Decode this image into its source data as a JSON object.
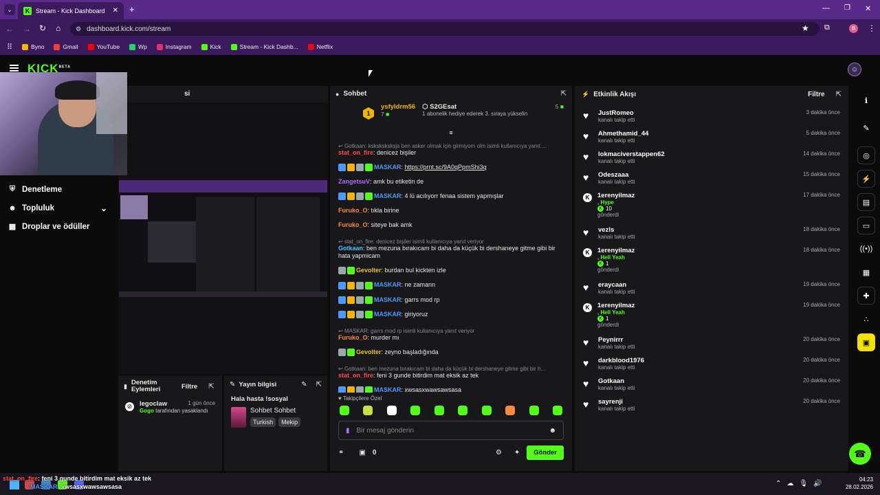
{
  "browser": {
    "tab_title": "Stream - Kick Dashboard",
    "url": "dashboard.kick.com/stream",
    "profile_initial": "B",
    "bookmarks": [
      {
        "label": "Byno",
        "color": "#f4b400"
      },
      {
        "label": "Gmail",
        "color": "#ea4335"
      },
      {
        "label": "YouTube",
        "color": "#ff0000"
      },
      {
        "label": "Wp",
        "color": "#25d366"
      },
      {
        "label": "Instagram",
        "color": "#e1306c"
      },
      {
        "label": "Kick",
        "color": "#53fc18"
      },
      {
        "label": "Stream - Kick Dashb...",
        "color": "#53fc18"
      },
      {
        "label": "Netflix",
        "color": "#e50914"
      }
    ]
  },
  "logo": {
    "text": "KICK",
    "beta": "BETA"
  },
  "sidebar": {
    "items": [
      {
        "label": "Denetleme",
        "icon": "shield-icon"
      },
      {
        "label": "Topluluk",
        "icon": "users-icon"
      },
      {
        "label": "Droplar ve ödüller",
        "icon": "gift-icon"
      }
    ]
  },
  "cam_partial_label": "si",
  "chat": {
    "title": "Sohbet",
    "top_user": "ysfyldrm56",
    "top_count": "7",
    "top_rank": "1",
    "second_user": "S2GEsat",
    "second_count": "5",
    "second_note": "1 abonelik hediye ederek 3. sıraya yükselin",
    "messages": [
      {
        "type": "reply",
        "text": "Gotkaan: ksksksksksjs ben asker olmak için girmiyom olm isimli kullanıcıya yanıt ..."
      },
      {
        "user": "stat_on_fire",
        "color": "#ff4b4b",
        "text": "denicez bişiler",
        "badges": []
      },
      {
        "user": "MASKAR",
        "color": "#4c9aff",
        "text": "https://prnt.sc/9A0qPpmShi3q",
        "link": true,
        "badges": [
          "#4c9aff",
          "#f4b400",
          "#9aa",
          "#53fc18"
        ]
      },
      {
        "user": "ZangetsuV",
        "color": "#b36bff",
        "text": "amk bu etiketin de",
        "badges": []
      },
      {
        "user": "MASKAR",
        "color": "#4c9aff",
        "text": "4 lü acılıyorr fenaa sistem yapmışlar",
        "badges": [
          "#4c9aff",
          "#f4b400",
          "#9aa",
          "#53fc18"
        ]
      },
      {
        "user": "Furuko_O",
        "color": "#ff8a3d",
        "text": "tıkla birine",
        "badges": []
      },
      {
        "user": "Furuko_O",
        "color": "#ff8a3d",
        "text": "siteye bak amk",
        "badges": []
      },
      {
        "type": "reply",
        "text": "stat_on_fire: denicez bişiler isimli kullanıcıya yanıt veriyor"
      },
      {
        "user": "Gotkaan",
        "color": "#4cc3ff",
        "text": "ben mezuna bırakıcam bi daha da küçük bi dershaneye gitme gibi bir hata yapmicam",
        "badges": []
      },
      {
        "user": "Gevolter",
        "color": "#e6c229",
        "text": "burdan bul kickten izle",
        "badges": [
          "#9aa",
          "#53fc18"
        ]
      },
      {
        "user": "MASKAR",
        "color": "#4c9aff",
        "text": "ne zamann",
        "badges": [
          "#4c9aff",
          "#f4b400",
          "#9aa",
          "#53fc18"
        ]
      },
      {
        "user": "MASKAR",
        "color": "#4c9aff",
        "text": "garrs mod rp",
        "badges": [
          "#4c9aff",
          "#f4b400",
          "#9aa",
          "#53fc18"
        ]
      },
      {
        "user": "MASKAR",
        "color": "#4c9aff",
        "text": "giriyoruz",
        "badges": [
          "#4c9aff",
          "#f4b400",
          "#9aa",
          "#53fc18"
        ]
      },
      {
        "type": "reply",
        "text": "MASKAR: garrs mod rp isimli kullanıcıya yanıt veriyor"
      },
      {
        "user": "Furuko_O",
        "color": "#ff8a3d",
        "text": "murder mı",
        "badges": []
      },
      {
        "user": "Gevolter",
        "color": "#e6c229",
        "text": "zeyno başladığında",
        "badges": [
          "#9aa",
          "#53fc18"
        ]
      },
      {
        "type": "reply",
        "text": "Gotkaan: ben mezuna bırakıcam bi daha da küçük bi dershaneye gitme gibi bir h..."
      },
      {
        "user": "stat_on_fire",
        "color": "#ff4b4b",
        "text": "feni 3 gunde bitirdim mat eksik az tek",
        "badges": []
      },
      {
        "user": "MASKAR",
        "color": "#4c9aff",
        "text": "xwsasxwawsawsasa",
        "badges": [
          "#4c9aff",
          "#f4b400",
          "#9aa",
          "#53fc18"
        ]
      }
    ],
    "emote_section": "Takipçilere Özel",
    "input_placeholder": "Bir mesaj gönderin",
    "points": "0",
    "send_label": "Gönder"
  },
  "mod_actions": {
    "title": "Denetim Eylemleri",
    "filter": "Filtre",
    "user": "legoclaw",
    "time": "1 gün önce",
    "actor": "Gogo",
    "action": "tarafından yasaklandı"
  },
  "stream_info": {
    "title": "Yayın bilgisi",
    "stream_title": "Hala hasta !sosyal",
    "category": "Sohbet Sohbet",
    "tags": [
      "Turkish",
      "Mekip"
    ]
  },
  "activity": {
    "title": "Etkinlik Akışı",
    "filter": "Filtre",
    "items": [
      {
        "kind": "follow",
        "name": "JustRomeo",
        "sub": "kanalı takip etti",
        "time": "3 dakika önce"
      },
      {
        "kind": "follow",
        "name": "Ahmethamid_44",
        "sub": "kanalı takip etti",
        "time": "5 dakika önce"
      },
      {
        "kind": "follow",
        "name": "lokmaciverstappen62",
        "sub": "kanalı takip etti",
        "time": "14 dakika önce"
      },
      {
        "kind": "follow",
        "name": "Odeszaaa",
        "sub": "kanalı takip etti",
        "time": "15 dakika önce"
      },
      {
        "kind": "kicks",
        "name": "1erenyilmaz",
        "gift": ", Hype",
        "amount": "10",
        "sub": "gönderdi",
        "time": "17 dakika önce"
      },
      {
        "kind": "follow",
        "name": "vezls",
        "sub": "kanalı takip etti",
        "time": "18 dakika önce"
      },
      {
        "kind": "kicks",
        "name": "1erenyilmaz",
        "gift": ", Hell Yeah",
        "amount": "1",
        "sub": "gönderdi",
        "time": "18 dakika önce"
      },
      {
        "kind": "follow",
        "name": "eraycaan",
        "sub": "kanalı takip etti",
        "time": "19 dakika önce"
      },
      {
        "kind": "kicks",
        "name": "1erenyilmaz",
        "gift": ", Hell Yeah",
        "amount": "1",
        "sub": "gönderdi",
        "time": "19 dakika önce"
      },
      {
        "kind": "follow",
        "name": "Peynirrr",
        "sub": "kanalı takip etti",
        "time": "20 dakika önce"
      },
      {
        "kind": "follow",
        "name": "darkblood1976",
        "sub": "kanalı takip etti",
        "time": "20 dakika önce"
      },
      {
        "kind": "follow",
        "name": "Gotkaan",
        "sub": "kanalı takip etti",
        "time": "20 dakika önce"
      },
      {
        "kind": "follow",
        "name": "sayrenji",
        "sub": "kanalı takip etti",
        "time": "20 dakika önce"
      }
    ]
  },
  "overlay": {
    "line1_user": "stat_on_fire",
    "line1_text": "feni 3 gunde bitirdim mat eksik az tek",
    "line2_user": "MASKAR",
    "line2_text": "xwsasxwawsawsasa"
  },
  "taskbar": {
    "time": "04:23",
    "date": "28.02.2026"
  }
}
